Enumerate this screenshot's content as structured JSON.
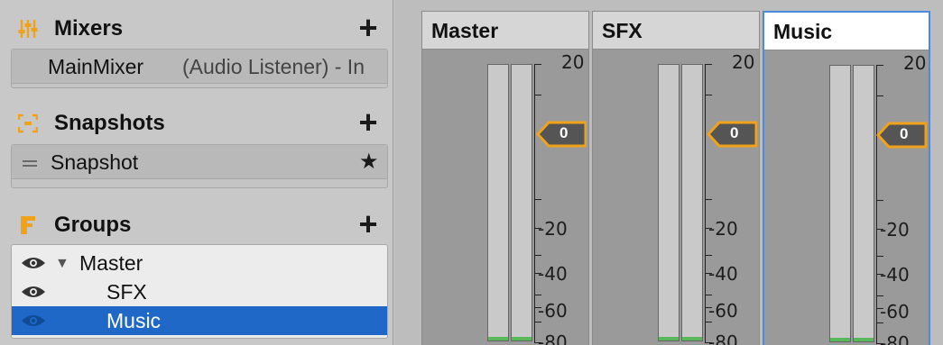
{
  "mixers": {
    "title": "Mixers",
    "add_label": "+",
    "items": [
      {
        "name": "MainMixer",
        "listener": "(Audio Listener) - In"
      }
    ]
  },
  "snapshots": {
    "title": "Snapshots",
    "add_label": "+",
    "items": [
      {
        "name": "Snapshot",
        "star": "★"
      }
    ]
  },
  "groups": {
    "title": "Groups",
    "add_label": "+",
    "items": [
      {
        "label": "Master",
        "expander": "▼",
        "selected": false
      },
      {
        "label": "SFX",
        "selected": false
      },
      {
        "label": "Music",
        "selected": true
      }
    ]
  },
  "strips": [
    {
      "name": "Master",
      "active": false,
      "attenuation": "0",
      "scale_labels": [
        "20",
        "-20",
        "-40",
        "-60",
        "-80"
      ]
    },
    {
      "name": "SFX",
      "active": false,
      "attenuation": "0",
      "scale_labels": [
        "20",
        "-20",
        "-40",
        "-60",
        "-80"
      ]
    },
    {
      "name": "Music",
      "active": true,
      "attenuation": "0",
      "scale_labels": [
        "20",
        "-20",
        "-40",
        "-60",
        "-80"
      ]
    }
  ],
  "colors": {
    "accent_orange": "#f0a21a",
    "selection_blue": "#1f68c8",
    "active_strip_border": "#4a8be0",
    "meter_floor_green": "#59b85a"
  },
  "icons": {
    "mixers": "sliders-icon",
    "snapshots": "camera-bracket-icon",
    "groups": "folder-icon",
    "visibility": "eye-icon",
    "favorite": "star-icon"
  }
}
